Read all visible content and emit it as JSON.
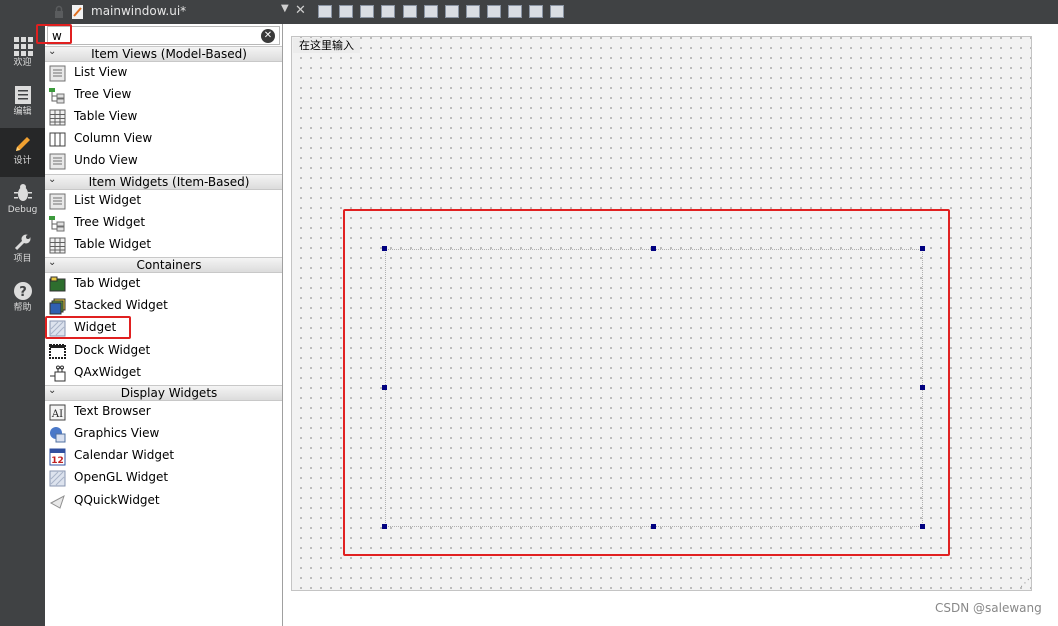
{
  "window": {
    "tab_title": "mainwindow.ui*",
    "dropdown_glyph": "▼",
    "close_glyph": "✕"
  },
  "modes": [
    {
      "label": "欢迎",
      "icon": "grid-icon"
    },
    {
      "label": "编辑",
      "icon": "document-icon"
    },
    {
      "label": "设计",
      "icon": "pencil-icon",
      "active": true
    },
    {
      "label": "Debug",
      "icon": "bug-icon"
    },
    {
      "label": "项目",
      "icon": "wrench-icon"
    },
    {
      "label": "帮助",
      "icon": "help-icon"
    }
  ],
  "widget_box": {
    "filter_value": "w",
    "filter_clear_glyph": "✕",
    "categories": [
      {
        "label": "Item Views (Model-Based)",
        "items": [
          "List View",
          "Tree View",
          "Table View",
          "Column View",
          "Undo View"
        ]
      },
      {
        "label": "Item Widgets (Item-Based)",
        "items": [
          "List Widget",
          "Tree Widget",
          "Table Widget"
        ]
      },
      {
        "label": "Containers",
        "items": [
          "Tab Widget",
          "Stacked Widget",
          "Widget",
          "Dock Widget",
          "QAxWidget"
        ]
      },
      {
        "label": "Display Widgets",
        "items": [
          "Text Browser",
          "Graphics View",
          "Calendar Widget",
          "OpenGL Widget",
          "QQuickWidget"
        ]
      }
    ],
    "calendar_icon_number": "12",
    "text_browser_icon_text": "AI"
  },
  "form": {
    "menu_placeholder": "在这里输入",
    "resize_grip_glyph": "⋰"
  },
  "colors": {
    "dark_bar": "#404244",
    "annotation": "#e02020",
    "handle": "#000080"
  },
  "watermark": "CSDN @salewang"
}
